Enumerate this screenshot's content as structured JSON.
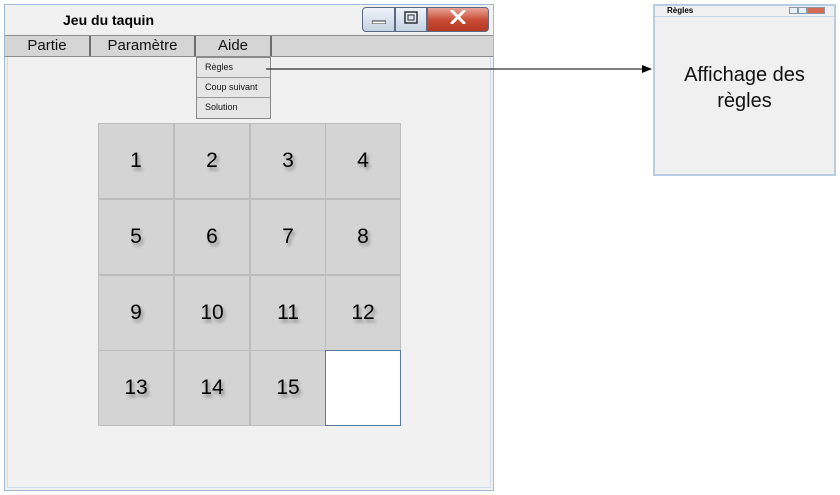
{
  "main_window": {
    "title": "Jeu du taquin",
    "menu": [
      "Partie",
      "Paramètre",
      "Aide"
    ],
    "aide_dropdown": [
      "Règles",
      "Coup suivant",
      "Solution"
    ]
  },
  "board": {
    "tiles": [
      "1",
      "2",
      "3",
      "4",
      "5",
      "6",
      "7",
      "8",
      "9",
      "10",
      "11",
      "12",
      "13",
      "14",
      "15",
      ""
    ]
  },
  "rules_window": {
    "title": "Règles",
    "body_line1": "Affichage des",
    "body_line2": "règles"
  },
  "colors": {
    "tile_fill": "#d4d4d4",
    "window_bg": "#f1f1f1",
    "close_button": "#c74a33"
  },
  "icons": [
    "minimize-icon",
    "maximize-icon",
    "close-icon",
    "arrow-connector"
  ]
}
